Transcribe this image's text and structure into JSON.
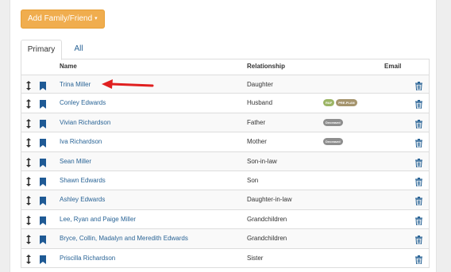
{
  "add_button": {
    "label": "Add Family/Friend",
    "caret": "▾"
  },
  "tabs": [
    {
      "label": "Primary",
      "active": true
    },
    {
      "label": "All",
      "active": false
    }
  ],
  "columns": {
    "name": "Name",
    "relationship": "Relationship",
    "email": "Email"
  },
  "colors": {
    "accent_orange": "#f0ad4e",
    "link_blue": "#2a6496",
    "bookmark_blue": "#1f5a95",
    "annotation_red": "#e02020",
    "badge_green": "#9cb565",
    "badge_tan": "#a5946d",
    "badge_grey": "#8e8e8e"
  },
  "icons": {
    "drag": "drag-handle-icon",
    "bookmark": "bookmark-icon",
    "delete": "trash-icon",
    "annotation": "red-arrow"
  },
  "rows": [
    {
      "name": "Trina Miller",
      "relationship": "Daughter",
      "badges": []
    },
    {
      "name": "Conley Edwards",
      "relationship": "Husband",
      "badges": [
        {
          "text": "R&F",
          "color": "#9cb565"
        },
        {
          "text": "PRE-PLAN",
          "color": "#a5946d"
        }
      ]
    },
    {
      "name": "Vivian Richardson",
      "relationship": "Father",
      "badges": [
        {
          "text": "Deceased",
          "color": "#8e8e8e"
        }
      ]
    },
    {
      "name": "Iva Richardson",
      "relationship": "Mother",
      "badges": [
        {
          "text": "Deceased",
          "color": "#8e8e8e"
        }
      ]
    },
    {
      "name": "Sean Miller",
      "relationship": "Son-in-law",
      "badges": []
    },
    {
      "name": "Shawn Edwards",
      "relationship": "Son",
      "badges": []
    },
    {
      "name": "Ashley Edwards",
      "relationship": "Daughter-in-law",
      "badges": []
    },
    {
      "name": "Lee, Ryan and Paige Miller",
      "relationship": "Grandchildren",
      "badges": []
    },
    {
      "name": "Bryce, Collin, Madalyn and Meredith Edwards",
      "relationship": "Grandchildren",
      "badges": []
    },
    {
      "name": "Priscilla Richardson",
      "relationship": "Sister",
      "badges": []
    }
  ]
}
